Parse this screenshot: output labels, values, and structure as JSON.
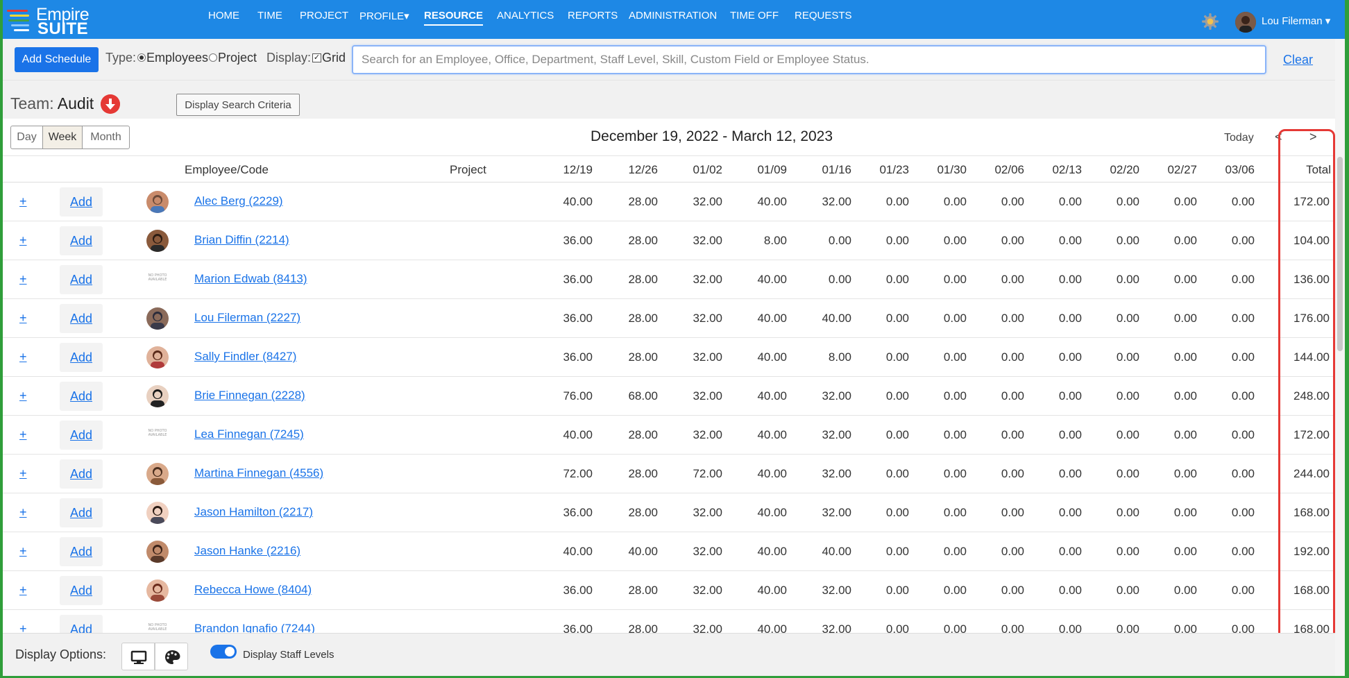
{
  "brand": {
    "word1": "Empire",
    "word2": "SUITE"
  },
  "nav": {
    "items": [
      {
        "label": "HOME"
      },
      {
        "label": "TIME"
      },
      {
        "label": "PROJECT"
      },
      {
        "label": "PROFILE▾"
      },
      {
        "label": "RESOURCE"
      },
      {
        "label": "ANALYTICS"
      },
      {
        "label": "REPORTS"
      },
      {
        "label": "ADMINISTRATION"
      },
      {
        "label": "TIME OFF"
      },
      {
        "label": "REQUESTS"
      }
    ],
    "active": "RESOURCE",
    "user_name": "Lou Filerman ▾"
  },
  "toolbar": {
    "add_schedule": "Add Schedule",
    "type_label": "Type:",
    "type_employees": "Employees",
    "type_project": "Project",
    "display_label": "Display:",
    "display_grid": "Grid",
    "search_placeholder": "Search for an Employee, Office, Department, Staff Level, Skill, Custom Field or Employee Status.",
    "clear": "Clear"
  },
  "team": {
    "label": "Team:",
    "name": "Audit",
    "criteria_button": "Display Search Criteria"
  },
  "view": {
    "day": "Day",
    "week": "Week",
    "month": "Month",
    "date_range": "December 19, 2022 - March 12, 2023",
    "today": "Today",
    "prev": "<",
    "next": ">"
  },
  "grid": {
    "col_employee": "Employee/Code",
    "col_project": "Project",
    "weeks": [
      "12/19",
      "12/26",
      "01/02",
      "01/09",
      "01/16",
      "01/23",
      "01/30",
      "02/06",
      "02/13",
      "02/20",
      "02/27",
      "03/06"
    ],
    "col_total": "Total",
    "plus_label": "+",
    "add_label": "Add",
    "no_photo_text": "NO PHOTO AVAILABLE",
    "rows": [
      {
        "name": "Alec Berg (2229)",
        "photo": true,
        "values": [
          "40.00",
          "28.00",
          "32.00",
          "40.00",
          "32.00",
          "0.00",
          "0.00",
          "0.00",
          "0.00",
          "0.00",
          "0.00",
          "0.00"
        ],
        "total": "172.00"
      },
      {
        "name": "Brian Diffin (2214)",
        "photo": true,
        "values": [
          "36.00",
          "28.00",
          "32.00",
          "8.00",
          "0.00",
          "0.00",
          "0.00",
          "0.00",
          "0.00",
          "0.00",
          "0.00",
          "0.00"
        ],
        "total": "104.00"
      },
      {
        "name": "Marion Edwab (8413)",
        "photo": false,
        "values": [
          "36.00",
          "28.00",
          "32.00",
          "40.00",
          "0.00",
          "0.00",
          "0.00",
          "0.00",
          "0.00",
          "0.00",
          "0.00",
          "0.00"
        ],
        "total": "136.00"
      },
      {
        "name": "Lou Filerman (2227)",
        "photo": true,
        "values": [
          "36.00",
          "28.00",
          "32.00",
          "40.00",
          "40.00",
          "0.00",
          "0.00",
          "0.00",
          "0.00",
          "0.00",
          "0.00",
          "0.00"
        ],
        "total": "176.00"
      },
      {
        "name": "Sally Findler (8427)",
        "photo": true,
        "values": [
          "36.00",
          "28.00",
          "32.00",
          "40.00",
          "8.00",
          "0.00",
          "0.00",
          "0.00",
          "0.00",
          "0.00",
          "0.00",
          "0.00"
        ],
        "total": "144.00"
      },
      {
        "name": "Brie Finnegan (2228)",
        "photo": true,
        "values": [
          "76.00",
          "68.00",
          "32.00",
          "40.00",
          "32.00",
          "0.00",
          "0.00",
          "0.00",
          "0.00",
          "0.00",
          "0.00",
          "0.00"
        ],
        "total": "248.00"
      },
      {
        "name": "Lea Finnegan (7245)",
        "photo": false,
        "values": [
          "40.00",
          "28.00",
          "32.00",
          "40.00",
          "32.00",
          "0.00",
          "0.00",
          "0.00",
          "0.00",
          "0.00",
          "0.00",
          "0.00"
        ],
        "total": "172.00"
      },
      {
        "name": "Martina Finnegan (4556)",
        "photo": true,
        "values": [
          "72.00",
          "28.00",
          "72.00",
          "40.00",
          "32.00",
          "0.00",
          "0.00",
          "0.00",
          "0.00",
          "0.00",
          "0.00",
          "0.00"
        ],
        "total": "244.00"
      },
      {
        "name": "Jason Hamilton (2217)",
        "photo": true,
        "values": [
          "36.00",
          "28.00",
          "32.00",
          "40.00",
          "32.00",
          "0.00",
          "0.00",
          "0.00",
          "0.00",
          "0.00",
          "0.00",
          "0.00"
        ],
        "total": "168.00"
      },
      {
        "name": "Jason Hanke (2216)",
        "photo": true,
        "values": [
          "40.00",
          "40.00",
          "32.00",
          "40.00",
          "40.00",
          "0.00",
          "0.00",
          "0.00",
          "0.00",
          "0.00",
          "0.00",
          "0.00"
        ],
        "total": "192.00"
      },
      {
        "name": "Rebecca Howe (8404)",
        "photo": true,
        "values": [
          "36.00",
          "28.00",
          "32.00",
          "40.00",
          "32.00",
          "0.00",
          "0.00",
          "0.00",
          "0.00",
          "0.00",
          "0.00",
          "0.00"
        ],
        "total": "168.00"
      },
      {
        "name": "Brandon Ignafio (7244)",
        "photo": false,
        "values": [
          "36.00",
          "28.00",
          "32.00",
          "40.00",
          "32.00",
          "0.00",
          "0.00",
          "0.00",
          "0.00",
          "0.00",
          "0.00",
          "0.00"
        ],
        "total": "168.00"
      }
    ]
  },
  "footer": {
    "display_options": "Display Options:",
    "staff_levels": "Display Staff Levels"
  },
  "colors": {
    "nav_bg": "#1e88e5",
    "primary": "#1a73e8",
    "highlight": "#e53935"
  },
  "icons": {
    "settings": "gear-icon",
    "team_toggle": "arrow-down-circle-icon",
    "monitor": "monitor-icon",
    "palette": "palette-icon"
  }
}
